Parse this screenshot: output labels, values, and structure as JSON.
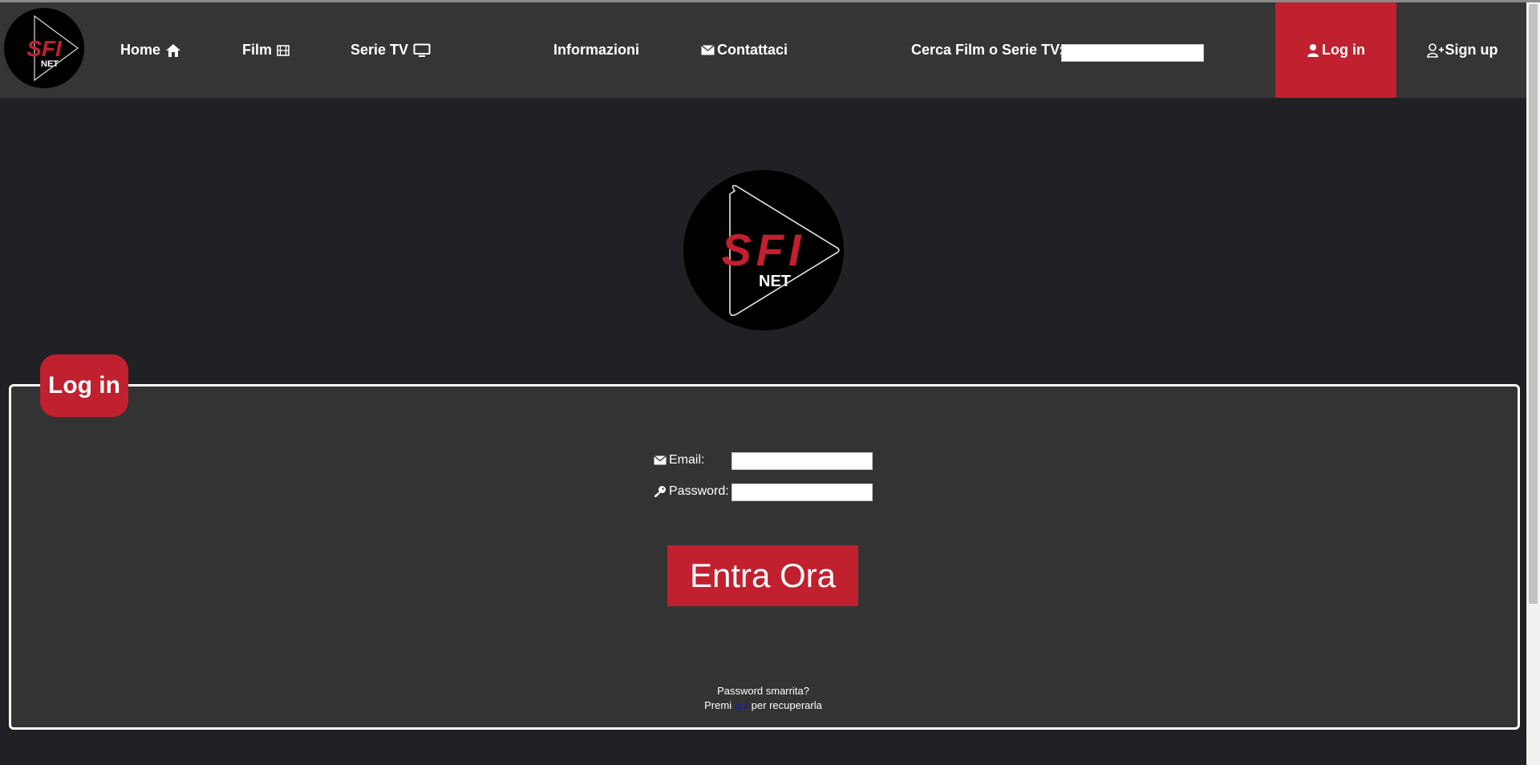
{
  "nav": {
    "home": "Home",
    "film": "Film",
    "serie_tv": "Serie TV",
    "informazioni": "Informazioni",
    "contattaci": "Contattaci",
    "search_label": "Cerca Film o Serie TV:",
    "search_value": "",
    "login": "Log in",
    "signup": "Sign up"
  },
  "logo": {
    "brand": "SFI",
    "sub": "NET"
  },
  "login_form": {
    "badge": "Log in",
    "email_label": "Email:",
    "email_value": "",
    "password_label": "Password:",
    "password_value": "",
    "submit": "Entra Ora",
    "lost_title": "Password smarrita?",
    "lost_prefix": "Premi ",
    "lost_link": "qui",
    "lost_suffix": " per recuperarla"
  },
  "colors": {
    "accent": "#c1202f",
    "navbar": "#353535",
    "background": "#202124",
    "panel": "#333333"
  }
}
